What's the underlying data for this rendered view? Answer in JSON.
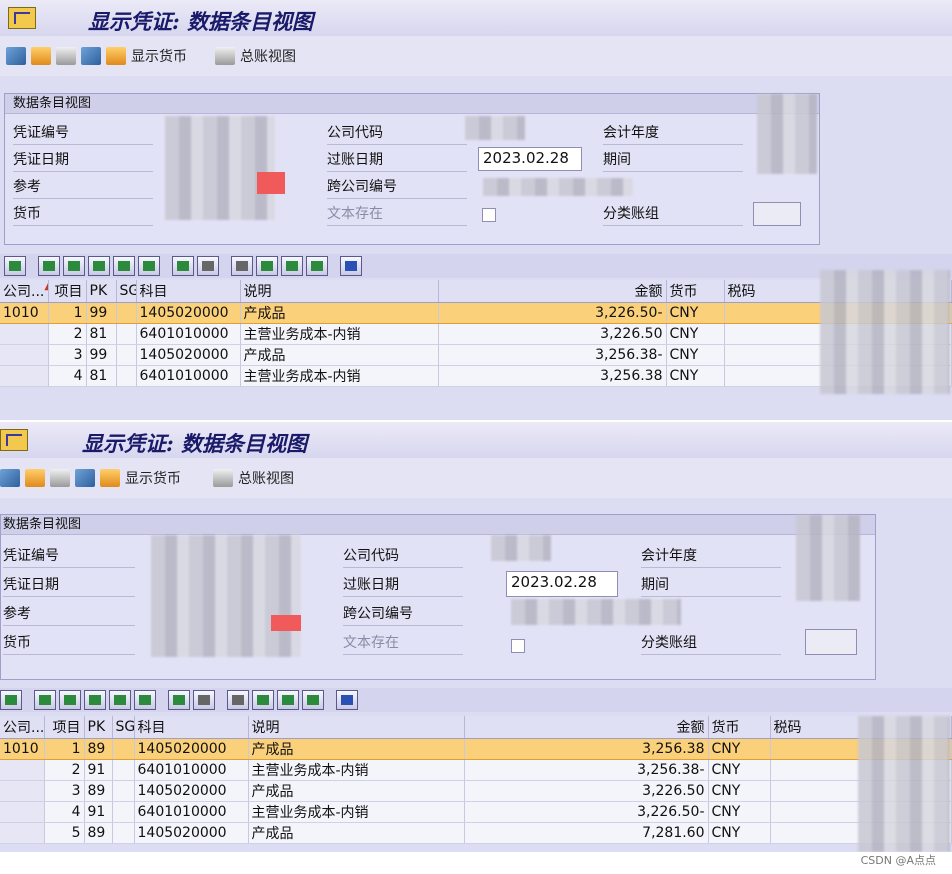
{
  "screen1": {
    "title": "显示凭证: 数据条目视图",
    "toolbar": {
      "currency_label": "显示货币",
      "ledger_label": "总账视图"
    },
    "header_group": {
      "title": "数据条目视图",
      "labels": [
        "凭证编号",
        "凭证日期",
        "参考",
        "货币",
        "公司代码",
        "过账日期",
        "跨公司编号",
        "文本存在",
        "会计年度",
        "期间",
        "分类账组"
      ],
      "posting_date": "2023.02.28"
    },
    "columns": [
      "公司...",
      "项目",
      "PK",
      "SG",
      "科目",
      "说明",
      "金额",
      "货币",
      "税码"
    ],
    "rows": [
      {
        "company": "1010",
        "item": "1",
        "pk": "99",
        "sg": "",
        "account": "1405020000",
        "text": "产成品",
        "amount": "3,226.50-",
        "currency": "CNY"
      },
      {
        "company": "",
        "item": "2",
        "pk": "81",
        "sg": "",
        "account": "6401010000",
        "text": "主营业务成本-内销",
        "amount": "3,226.50",
        "currency": "CNY"
      },
      {
        "company": "",
        "item": "3",
        "pk": "99",
        "sg": "",
        "account": "1405020000",
        "text": "产成品",
        "amount": "3,256.38-",
        "currency": "CNY"
      },
      {
        "company": "",
        "item": "4",
        "pk": "81",
        "sg": "",
        "account": "6401010000",
        "text": "主营业务成本-内销",
        "amount": "3,256.38",
        "currency": "CNY"
      }
    ]
  },
  "screen2": {
    "title": "显示凭证: 数据条目视图",
    "toolbar": {
      "currency_label": "显示货币",
      "ledger_label": "总账视图"
    },
    "header_group": {
      "title": "数据条目视图",
      "labels": [
        "凭证编号",
        "凭证日期",
        "参考",
        "货币",
        "公司代码",
        "过账日期",
        "跨公司编号",
        "文本存在",
        "会计年度",
        "期间",
        "分类账组"
      ],
      "posting_date": "2023.02.28"
    },
    "columns": [
      "公司...",
      "项目",
      "PK",
      "SG",
      "科目",
      "说明",
      "金额",
      "货币",
      "税码"
    ],
    "rows": [
      {
        "company": "1010",
        "item": "1",
        "pk": "89",
        "sg": "",
        "account": "1405020000",
        "text": "产成品",
        "amount": "3,256.38",
        "currency": "CNY"
      },
      {
        "company": "",
        "item": "2",
        "pk": "91",
        "sg": "",
        "account": "6401010000",
        "text": "主营业务成本-内销",
        "amount": "3,256.38-",
        "currency": "CNY"
      },
      {
        "company": "",
        "item": "3",
        "pk": "89",
        "sg": "",
        "account": "1405020000",
        "text": "产成品",
        "amount": "3,226.50",
        "currency": "CNY"
      },
      {
        "company": "",
        "item": "4",
        "pk": "91",
        "sg": "",
        "account": "6401010000",
        "text": "主营业务成本-内销",
        "amount": "3,226.50-",
        "currency": "CNY"
      },
      {
        "company": "",
        "item": "5",
        "pk": "89",
        "sg": "",
        "account": "1405020000",
        "text": "产成品",
        "amount": "7,281.60",
        "currency": "CNY"
      }
    ]
  },
  "watermark": "CSDN @A点点"
}
